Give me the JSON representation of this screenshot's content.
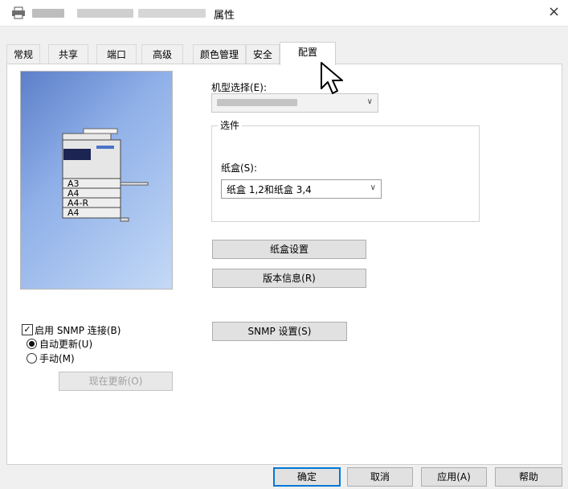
{
  "window": {
    "title": "属性",
    "close_glyph": "×"
  },
  "tabs": [
    {
      "label": "常规"
    },
    {
      "label": "共享"
    },
    {
      "label": "端口"
    },
    {
      "label": "高级"
    },
    {
      "label": "颜色管理"
    },
    {
      "label": "安全"
    },
    {
      "label": "配置",
      "active": true
    }
  ],
  "preview": {
    "paper_labels": [
      "A3",
      "A4",
      "A4-R",
      "A4"
    ]
  },
  "model": {
    "label": "机型选择(E):"
  },
  "options": {
    "group_label": "选件",
    "tray_label": "纸盒(S):",
    "tray_value": "纸盒 1,2和纸盒 3,4"
  },
  "buttons": {
    "tray_settings": "纸盒设置",
    "version_info": "版本信息(R)",
    "snmp_settings": "SNMP 设置(S)",
    "update_now": "现在更新(O)"
  },
  "snmp": {
    "enable_label": "启用 SNMP 连接(B)",
    "enabled": true,
    "auto_label": "自动更新(U)",
    "manual_label": "手动(M)",
    "selected": "auto"
  },
  "footer": {
    "ok": "确定",
    "cancel": "取消",
    "apply": "应用(A)",
    "help": "帮助"
  },
  "colors": {
    "accent": "#0078d7"
  }
}
